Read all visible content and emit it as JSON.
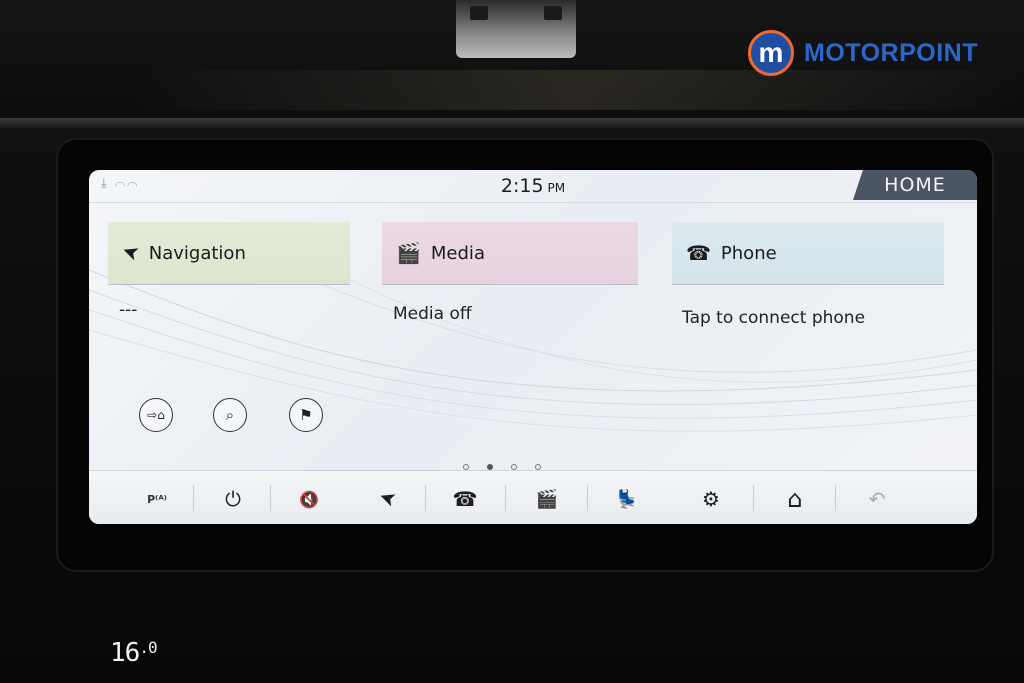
{
  "brand": {
    "logo_letter": "m",
    "name": "MOTORPOINT",
    "primary_color": "#2b67c8",
    "ring_color": "#f06a2a"
  },
  "status": {
    "icons": "⤓ ⌒⌒",
    "time": "2:15",
    "ampm": "PM",
    "home_label": "HOME"
  },
  "cards": {
    "navigation": {
      "title": "Navigation",
      "icon": "➤",
      "text": "---"
    },
    "media": {
      "title": "Media",
      "icon": "🎬",
      "text": "Media off"
    },
    "phone": {
      "title": "Phone",
      "icon": "☎",
      "text": "Tap to connect phone"
    }
  },
  "nav_shortcuts": [
    {
      "name": "home-destination",
      "icon": "⇨⌂"
    },
    {
      "name": "search",
      "icon": "⌕"
    },
    {
      "name": "destination-flag",
      "icon": "⚑"
    }
  ],
  "pager": {
    "count": 4,
    "active_index": 1
  },
  "dock": [
    {
      "name": "parking-aid",
      "icon": "P⁽ᴬ⁾"
    },
    {
      "name": "power",
      "icon": "⏻"
    },
    {
      "name": "mute",
      "icon": "🔇"
    },
    {
      "name": "navigation",
      "icon": "➤"
    },
    {
      "name": "phone",
      "icon": "☎"
    },
    {
      "name": "media",
      "icon": "🎬"
    },
    {
      "name": "seat",
      "icon": "💺"
    },
    {
      "name": "settings",
      "icon": "⚙"
    },
    {
      "name": "home",
      "icon": "⌂"
    },
    {
      "name": "back",
      "icon": "↶"
    }
  ],
  "climate": {
    "temperature": "16",
    "temperature_decimal": ".0"
  }
}
